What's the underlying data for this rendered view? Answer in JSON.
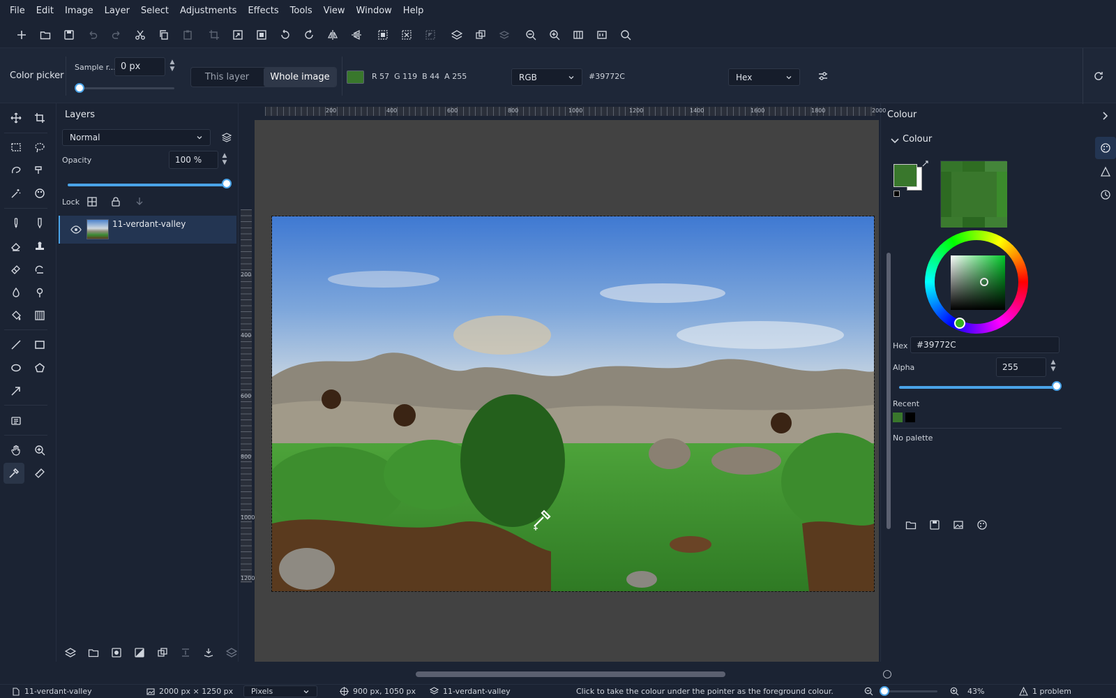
{
  "menu": [
    "File",
    "Edit",
    "Image",
    "Layer",
    "Select",
    "Adjustments",
    "Effects",
    "Tools",
    "View",
    "Window",
    "Help"
  ],
  "toolbar_icons": [
    "new-icon",
    "open-icon",
    "save-icon",
    "undo-icon",
    "redo-icon",
    "cut-icon",
    "copy-icon",
    "paste-icon",
    "crop-icon",
    "resize-image-icon",
    "resize-canvas-icon",
    "rotate-ccw-icon",
    "rotate-cw-icon",
    "flip-horizontal-icon",
    "flip-vertical-icon",
    "select-all-icon",
    "deselect-icon",
    "invert-selection-icon",
    "add-layer-icon",
    "duplicate-layer-icon",
    "merge-layer-icon",
    "zoom-out-icon",
    "zoom-in-icon",
    "zoom-fit-icon",
    "actual-size-icon",
    "search-icon"
  ],
  "options": {
    "tool_name": "Color picker",
    "sample_label": "Sample r...",
    "sample_value": "0 px",
    "sample_level": 0,
    "mode_options": [
      "This layer",
      "Whole image"
    ],
    "mode_selected": "Whole image",
    "swatch_color": "#39772C",
    "rgba_text": "R 57  G 119  B 44  A 255",
    "color_model": "RGB",
    "hex_readout": "#39772C",
    "format": "Hex"
  },
  "layers": {
    "title": "Layers",
    "blend_mode": "Normal",
    "opacity_label": "Opacity",
    "opacity_value": "100 %",
    "opacity_level": 1.0,
    "lock_label": "Lock",
    "items": [
      {
        "name": "11-verdant-valley",
        "visible": true,
        "selected": true
      }
    ]
  },
  "rulers": {
    "h_labels": [
      "200",
      "400",
      "600",
      "800",
      "1000",
      "1200",
      "1400",
      "1600",
      "1800",
      "2000"
    ],
    "v_labels": [
      "200",
      "400",
      "600",
      "800",
      "1000",
      "1200"
    ]
  },
  "colour": {
    "panel_title": "Colour",
    "section_title": "Colour",
    "primary": "#39772C",
    "secondary": "#FFFFFF",
    "hex_label": "Hex",
    "hex_value": "#39772C",
    "alpha_label": "Alpha",
    "alpha_value": "255",
    "alpha_level": 1.0,
    "recent_label": "Recent",
    "recent_colors": [
      "#39772C",
      "#000000"
    ],
    "palette_text": "No palette"
  },
  "status": {
    "document": "11-verdant-valley",
    "image_size": "2000 px × 1250 px",
    "units": "Pixels",
    "cursor_pos": "900 px, 1050 px",
    "layer": "11-verdant-valley",
    "hint": "Click to take the colour under the pointer as the foreground colour.",
    "zoom": "43%",
    "problems": "1 problem"
  }
}
